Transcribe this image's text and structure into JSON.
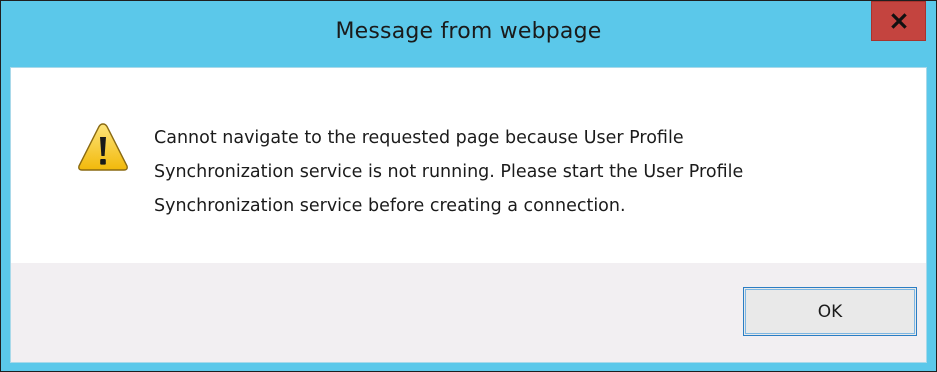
{
  "dialog": {
    "title": "Message from webpage",
    "close_glyph": "x",
    "message": "Cannot navigate to the requested page because User Profile\nSynchronization service is not running. Please start the User Profile\nSynchronization service before creating a connection.",
    "icon": "warning-icon",
    "ok_label": "OK"
  },
  "colors": {
    "titlebar": "#5bc8ea",
    "close_button": "#c4443f",
    "button_area": "#f2eff2",
    "warning_fill": "#f5c80f"
  }
}
